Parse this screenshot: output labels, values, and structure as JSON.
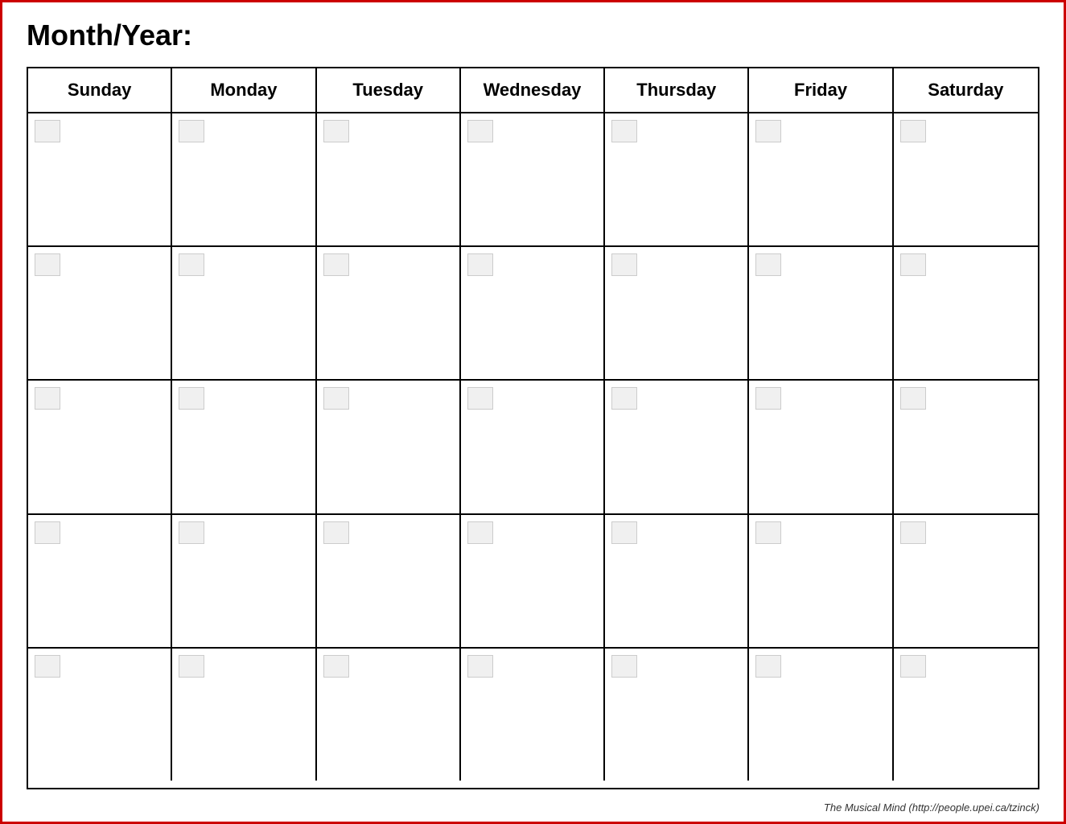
{
  "header": {
    "month_year_label": "Month/Year:"
  },
  "calendar": {
    "days": [
      "Sunday",
      "Monday",
      "Tuesday",
      "Wednesday",
      "Thursday",
      "Friday",
      "Saturday"
    ],
    "rows": 5,
    "cells_per_row": 7
  },
  "footer": {
    "credit": "The Musical Mind  (http://people.upei.ca/tzinck)"
  },
  "colors": {
    "border": "#000000",
    "page_border": "#cc0000",
    "background": "#ffffff",
    "date_box_bg": "#f0f0f0",
    "date_box_border": "#cccccc"
  }
}
